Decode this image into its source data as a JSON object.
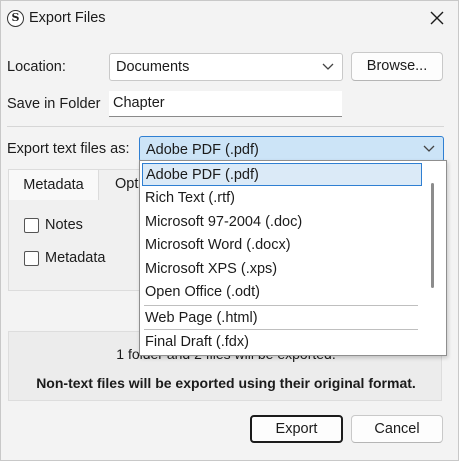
{
  "window": {
    "title": "Export Files",
    "app_icon_letter": "S"
  },
  "location": {
    "label": "Location:",
    "value": "Documents",
    "browse_label": "Browse..."
  },
  "save_folder": {
    "label": "Save in Folder",
    "value": "Chapter"
  },
  "export_as": {
    "label": "Export text files as:",
    "value": "Adobe PDF (.pdf)"
  },
  "tabs": [
    {
      "label": "Metadata"
    },
    {
      "label": "Opt"
    }
  ],
  "options": [
    {
      "label": "Notes",
      "checked": false
    },
    {
      "label": "Metadata",
      "checked": false
    }
  ],
  "info": {
    "summary": "1 folder and 2 files will be exported.",
    "note": "Non-text files will be exported using their original format."
  },
  "dropdown": {
    "items": [
      {
        "label": "Adobe PDF (.pdf)",
        "selected": true
      },
      {
        "label": "Rich Text (.rtf)"
      },
      {
        "label": "Microsoft 97-2004 (.doc)"
      },
      {
        "label": "Microsoft Word (.docx)"
      },
      {
        "label": "Microsoft XPS (.xps)"
      },
      {
        "label": "Open Office (.odt)"
      },
      {
        "label": "Web Page (.html)"
      },
      {
        "label": "Final Draft (.fdx)"
      }
    ]
  },
  "buttons": {
    "export_label": "Export",
    "cancel_label": "Cancel"
  },
  "colors": {
    "accent": "#2f7fd2",
    "selection_fill": "#dbeaf7",
    "background": "#f3f3f3"
  }
}
